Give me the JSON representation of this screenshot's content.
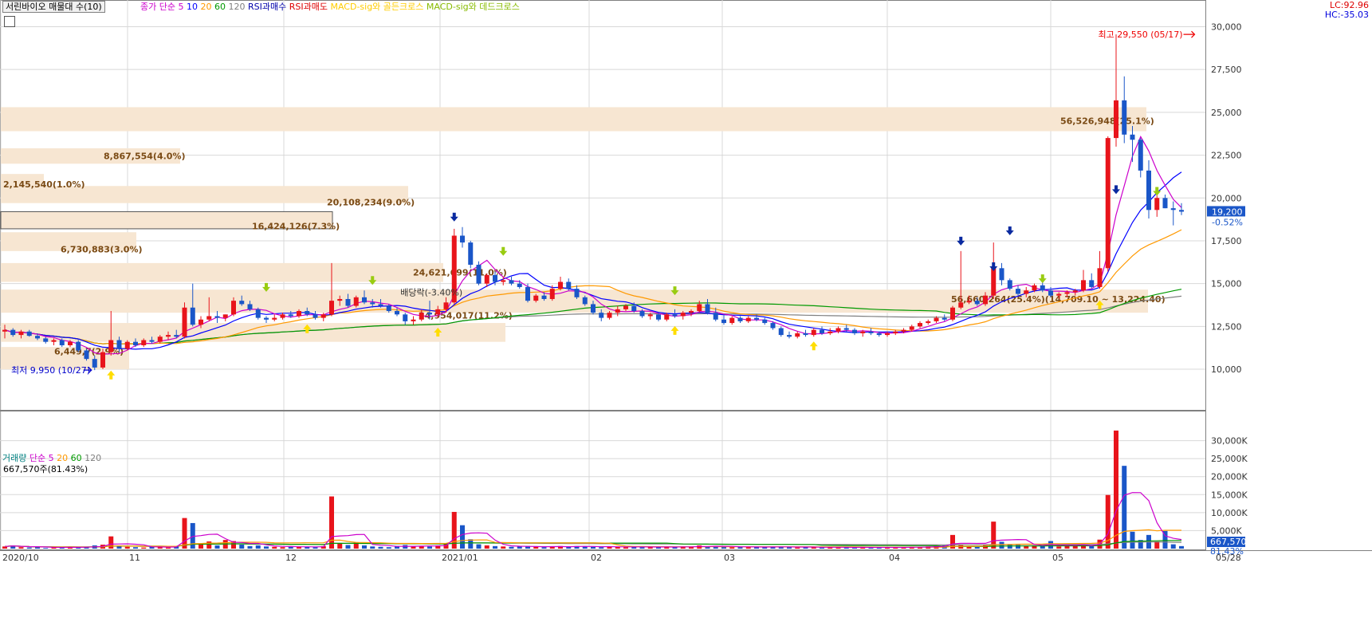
{
  "header": {
    "title": "서린바이오 매물대 수(10)",
    "legend": [
      {
        "text": "종가",
        "color": "#cc00cc"
      },
      {
        "text": "단순",
        "color": "#cc00cc"
      },
      {
        "text": "5",
        "color": "#cc00cc"
      },
      {
        "text": "10",
        "color": "#0000ff"
      },
      {
        "text": "20",
        "color": "#ff9900"
      },
      {
        "text": "60",
        "color": "#009900"
      },
      {
        "text": "120",
        "color": "#808080"
      }
    ],
    "signals": [
      {
        "text": "RSI과매수",
        "color": "#0000aa"
      },
      {
        "text": "RSI과매도",
        "color": "#dd0000"
      },
      {
        "text": "MACD-sig와 골든크로스",
        "color": "#ffcc00"
      },
      {
        "text": "MACD-sig와 데드크로스",
        "color": "#88bb00"
      }
    ],
    "lc": "LC:92.96",
    "hc": "HC:-35.03"
  },
  "volume_header": {
    "legend": [
      {
        "text": "거래량",
        "color": "#008080"
      },
      {
        "text": "단순",
        "color": "#cc00cc"
      },
      {
        "text": "5",
        "color": "#cc00cc"
      },
      {
        "text": "20",
        "color": "#ff9900"
      },
      {
        "text": "60",
        "color": "#009900"
      },
      {
        "text": "120",
        "color": "#808080"
      }
    ],
    "current": "667,570주(81.43%)"
  },
  "colors": {
    "up": "#e8141b",
    "down": "#1a56c8",
    "profile": "#f7e6d2",
    "grid": "#d8d8d8"
  },
  "chart_data": [
    {
      "type": "candlestick",
      "title": "서린바이오 매물대 수(10)",
      "ylim": [
        8000,
        31000
      ],
      "y_ticks": [
        "10,000",
        "12,500",
        "15,000",
        "17,500",
        "20,000",
        "22,500",
        "25,000",
        "27,500",
        "30,000"
      ],
      "x_ticks": [
        "2020/10",
        "11",
        "12",
        "2021/01",
        "02",
        "03",
        "04",
        "05",
        "05/28"
      ],
      "last_price": "19,200",
      "last_change": "-0.52%",
      "ohlc": [
        [
          12200,
          12600,
          11800,
          12300
        ],
        [
          12300,
          12400,
          11900,
          12000
        ],
        [
          12000,
          12300,
          11800,
          12200
        ],
        [
          12200,
          12300,
          11900,
          11950
        ],
        [
          11950,
          12100,
          11700,
          11800
        ],
        [
          11800,
          11900,
          11500,
          11600
        ],
        [
          11600,
          11800,
          11400,
          11700
        ],
        [
          11700,
          11800,
          11300,
          11400
        ],
        [
          11400,
          11700,
          11300,
          11600
        ],
        [
          11600,
          11700,
          11000,
          11100
        ],
        [
          11100,
          11200,
          10500,
          10600
        ],
        [
          10600,
          10800,
          9950,
          10100
        ],
        [
          10100,
          11200,
          10000,
          11000
        ],
        [
          11000,
          13400,
          10800,
          11700
        ],
        [
          11700,
          11900,
          11000,
          11200
        ],
        [
          11200,
          11700,
          11100,
          11600
        ],
        [
          11600,
          11800,
          11300,
          11400
        ],
        [
          11400,
          11800,
          11300,
          11700
        ],
        [
          11700,
          11900,
          11500,
          11600
        ],
        [
          11600,
          12000,
          11500,
          11900
        ],
        [
          11900,
          12200,
          11700,
          12000
        ],
        [
          12000,
          12300,
          11800,
          11900
        ],
        [
          11900,
          13900,
          11800,
          13600
        ],
        [
          13600,
          15000,
          12500,
          12600
        ],
        [
          12600,
          13100,
          12400,
          12900
        ],
        [
          12900,
          14200,
          12800,
          13100
        ],
        [
          13100,
          13400,
          12700,
          13000
        ],
        [
          13000,
          13200,
          12800,
          13200
        ],
        [
          13200,
          14200,
          13100,
          14000
        ],
        [
          14000,
          14300,
          13700,
          13800
        ],
        [
          13800,
          14000,
          13400,
          13500
        ],
        [
          13500,
          13600,
          12900,
          13000
        ],
        [
          13000,
          13100,
          12700,
          12900
        ],
        [
          12900,
          13200,
          12800,
          13000
        ],
        [
          13000,
          13300,
          12900,
          13200
        ],
        [
          13200,
          13400,
          13000,
          13100
        ],
        [
          13100,
          13500,
          13000,
          13400
        ],
        [
          13400,
          13600,
          13100,
          13200
        ],
        [
          13200,
          13400,
          12900,
          13000
        ],
        [
          13000,
          13300,
          12800,
          13200
        ],
        [
          13200,
          16200,
          13100,
          14000
        ],
        [
          14000,
          14300,
          13700,
          14100
        ],
        [
          14100,
          14400,
          13600,
          13700
        ],
        [
          13700,
          14300,
          13600,
          14200
        ],
        [
          14200,
          14600,
          13800,
          13900
        ],
        [
          13900,
          14100,
          13600,
          13800
        ],
        [
          13800,
          14100,
          13600,
          13700
        ],
        [
          13700,
          13800,
          13300,
          13400
        ],
        [
          13400,
          13600,
          13100,
          13200
        ],
        [
          13200,
          13300,
          12600,
          12800
        ],
        [
          12800,
          13100,
          12600,
          12900
        ],
        [
          12900,
          13500,
          12800,
          13300
        ],
        [
          13300,
          14000,
          12900,
          13200
        ],
        [
          13200,
          13700,
          13000,
          13500
        ],
        [
          13500,
          14200,
          13300,
          13900
        ],
        [
          13900,
          18200,
          13800,
          17800
        ],
        [
          17800,
          18300,
          17100,
          17400
        ],
        [
          17400,
          17500,
          15900,
          16100
        ],
        [
          16100,
          16300,
          14900,
          15000
        ],
        [
          15000,
          15600,
          14800,
          15500
        ],
        [
          15500,
          15700,
          14900,
          15100
        ],
        [
          15100,
          15400,
          14900,
          15200
        ],
        [
          15200,
          15400,
          14900,
          15000
        ],
        [
          15000,
          15200,
          14700,
          14800
        ],
        [
          14800,
          15000,
          13900,
          14000
        ],
        [
          14000,
          14400,
          13900,
          14300
        ],
        [
          14300,
          14500,
          14000,
          14100
        ],
        [
          14100,
          14900,
          14000,
          14700
        ],
        [
          14700,
          15400,
          14600,
          15100
        ],
        [
          15100,
          15300,
          14600,
          14700
        ],
        [
          14700,
          14900,
          14100,
          14200
        ],
        [
          14200,
          14300,
          13700,
          13800
        ],
        [
          13800,
          14000,
          13200,
          13300
        ],
        [
          13300,
          13500,
          12800,
          13000
        ],
        [
          13000,
          13400,
          12900,
          13300
        ],
        [
          13300,
          13700,
          13100,
          13500
        ],
        [
          13500,
          13800,
          13400,
          13700
        ],
        [
          13700,
          13900,
          13300,
          13400
        ],
        [
          13400,
          13500,
          13000,
          13100
        ],
        [
          13100,
          13300,
          12900,
          13200
        ],
        [
          13200,
          13300,
          12800,
          12900
        ],
        [
          12900,
          13300,
          12800,
          13200
        ],
        [
          13200,
          13500,
          13000,
          13100
        ],
        [
          13100,
          13400,
          12900,
          13300
        ],
        [
          13300,
          13500,
          13100,
          13400
        ],
        [
          13400,
          14000,
          13300,
          13800
        ],
        [
          13800,
          14100,
          13200,
          13300
        ],
        [
          13300,
          13600,
          12800,
          12900
        ],
        [
          12900,
          13200,
          12600,
          12700
        ],
        [
          12700,
          13100,
          12600,
          13000
        ],
        [
          13000,
          13100,
          12700,
          12800
        ],
        [
          12800,
          13100,
          12700,
          13000
        ],
        [
          13000,
          13200,
          12800,
          12900
        ],
        [
          12900,
          13000,
          12600,
          12700
        ],
        [
          12700,
          12800,
          12300,
          12400
        ],
        [
          12400,
          12500,
          11900,
          12000
        ],
        [
          12000,
          12200,
          11800,
          11900
        ],
        [
          11900,
          12200,
          11800,
          12100
        ],
        [
          12100,
          12300,
          11900,
          12000
        ],
        [
          12000,
          12400,
          11900,
          12300
        ],
        [
          12300,
          12500,
          12000,
          12100
        ],
        [
          12100,
          12400,
          12000,
          12200
        ],
        [
          12200,
          12500,
          12100,
          12400
        ],
        [
          12400,
          12600,
          12200,
          12300
        ],
        [
          12300,
          12400,
          12000,
          12100
        ],
        [
          12100,
          12300,
          11900,
          12200
        ],
        [
          12200,
          12400,
          12000,
          12100
        ],
        [
          12100,
          12200,
          11900,
          12000
        ],
        [
          12000,
          12200,
          11900,
          12100
        ],
        [
          12100,
          12300,
          12000,
          12200
        ],
        [
          12200,
          12400,
          12100,
          12300
        ],
        [
          12300,
          12600,
          12200,
          12500
        ],
        [
          12500,
          12800,
          12400,
          12700
        ],
        [
          12700,
          12900,
          12600,
          12800
        ],
        [
          12800,
          13100,
          12700,
          13000
        ],
        [
          13000,
          13200,
          12800,
          12900
        ],
        [
          12900,
          13700,
          12800,
          13600
        ],
        [
          13600,
          16900,
          13500,
          13900
        ],
        [
          13900,
          14300,
          13800,
          14000
        ],
        [
          14000,
          14200,
          13700,
          13800
        ],
        [
          13800,
          14500,
          13700,
          14300
        ],
        [
          14300,
          17400,
          14100,
          15900
        ],
        [
          15900,
          16200,
          14900,
          15200
        ],
        [
          15200,
          15300,
          14600,
          14700
        ],
        [
          14700,
          14900,
          14300,
          14400
        ],
        [
          14400,
          14800,
          14200,
          14600
        ],
        [
          14600,
          15000,
          14500,
          14900
        ],
        [
          14900,
          15100,
          14500,
          14600
        ],
        [
          14600,
          14800,
          14200,
          14300
        ],
        [
          14300,
          14500,
          14100,
          14400
        ],
        [
          14400,
          14600,
          14200,
          14500
        ],
        [
          14500,
          14700,
          14300,
          14600
        ],
        [
          14600,
          15800,
          14500,
          15200
        ],
        [
          15200,
          15600,
          14700,
          14800
        ],
        [
          14800,
          16900,
          14700,
          15900
        ],
        [
          15900,
          23600,
          15700,
          23500
        ],
        [
          23500,
          29550,
          23000,
          25700
        ],
        [
          25700,
          27100,
          23200,
          23700
        ],
        [
          23700,
          24200,
          22100,
          23400
        ],
        [
          23400,
          23500,
          21200,
          21600
        ],
        [
          21600,
          22200,
          18800,
          19300
        ],
        [
          19300,
          20600,
          18900,
          20000
        ],
        [
          20000,
          20200,
          19400,
          19400
        ],
        [
          19400,
          19800,
          18400,
          19300
        ],
        [
          19300,
          19700,
          19000,
          19200
        ]
      ],
      "volume": [
        [
          600,
          900,
          400,
          300,
          500,
          200,
          400,
          300,
          500,
          400,
          350,
          900,
          1100,
          3400,
          700,
          500,
          400,
          300,
          600,
          500,
          300,
          600,
          8500,
          7100,
          1500,
          2000,
          900,
          2400,
          2100,
          1100,
          700,
          900,
          600,
          500,
          400,
          500,
          600,
          500,
          400,
          700,
          14500,
          1500,
          1000,
          1800,
          900,
          600,
          500,
          400,
          700,
          1000,
          600,
          700,
          600,
          900,
          1400,
          10200,
          6500,
          2600,
          1200,
          900,
          700,
          600,
          500,
          600,
          700,
          500,
          400,
          600,
          700,
          500,
          700,
          600,
          500,
          400,
          600,
          500,
          400,
          500,
          400,
          500,
          400,
          500,
          400,
          600,
          500,
          900,
          600,
          700,
          500,
          400,
          500,
          400,
          500,
          400,
          500,
          600,
          400,
          300,
          400,
          500,
          300,
          400,
          300,
          400,
          300,
          400,
          300,
          300,
          400,
          300,
          400,
          500,
          400,
          600,
          800,
          900,
          3800,
          1200,
          700,
          600,
          1000,
          7500,
          1900,
          1200,
          1000,
          800,
          900,
          700,
          2100,
          600,
          700,
          800,
          1200,
          1000,
          2500,
          14900,
          32800,
          23000,
          4700,
          2400,
          3800,
          2000,
          4900,
          1200,
          700
        ]
      ],
      "volume_ylim": [
        0,
        35000
      ],
      "volume_ticks": [
        "5,000K",
        "10,000K",
        "15,000K",
        "20,000K",
        "25,000K",
        "30,000K"
      ],
      "volume_last": "667,570",
      "volume_last_pct": "81.43%",
      "profile_labels": [
        "56,526,948(25.1%)",
        "8,867,554(4.0%)",
        "2,145,540(1.0%)",
        "20,108,234(9.0%)",
        "16,424,126(7.3%)",
        "6,730,883(3.0%)",
        "24,621,699(11.0%)",
        "24,954,017(11.2%)",
        "6,449,7(2.9%)",
        "56,660,264(25.4%)(14,709.10 ~ 13,224.40)"
      ],
      "annotations": {
        "high": "최고 29,550 (05/17)",
        "low": "최저 9,950 (10/27)",
        "dividend": "배당락(-3.40%)"
      }
    }
  ]
}
